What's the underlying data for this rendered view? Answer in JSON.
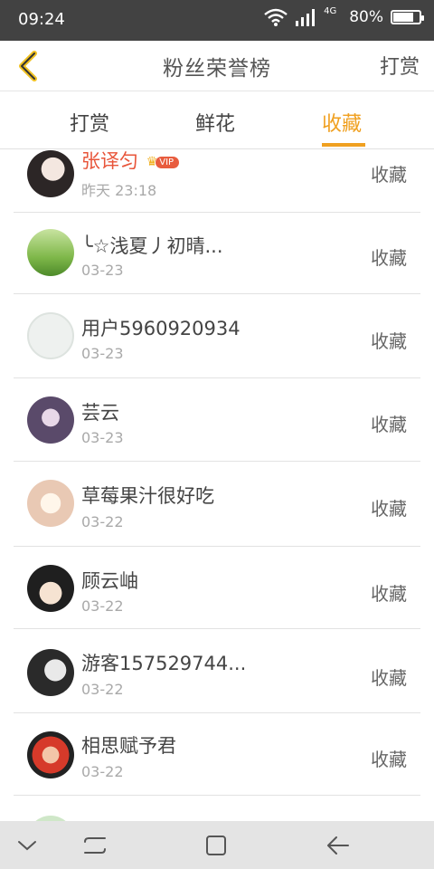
{
  "status": {
    "time": "09:24",
    "network": "4G",
    "battery_percent": "80%",
    "battery_level": 0.8
  },
  "header": {
    "back_icon": "chevron-left-icon",
    "title": "粉丝荣誉榜",
    "reward_label": "打赏"
  },
  "tabs": [
    {
      "label": "打赏"
    },
    {
      "label": "鲜花"
    },
    {
      "label": "收藏",
      "active": true
    }
  ],
  "accent_color": "#f0a020",
  "list": [
    {
      "name": "张译匀",
      "date": "昨天 23:18",
      "action": "收藏",
      "vip": "VIP",
      "name_color": "#e8553a"
    },
    {
      "name": "╰☆浅夏丿初晴...",
      "date": "03-23",
      "action": "收藏"
    },
    {
      "name": "用户5960920934",
      "date": "03-23",
      "action": "收藏"
    },
    {
      "name": "芸云",
      "date": "03-23",
      "action": "收藏"
    },
    {
      "name": "草莓果汁很好吃",
      "date": "03-22",
      "action": "收藏"
    },
    {
      "name": "顾云岫",
      "date": "03-22",
      "action": "收藏"
    },
    {
      "name": "游客157529744...",
      "date": "03-22",
      "action": "收藏"
    },
    {
      "name": "相思赋予君",
      "date": "03-22",
      "action": "收藏"
    }
  ]
}
